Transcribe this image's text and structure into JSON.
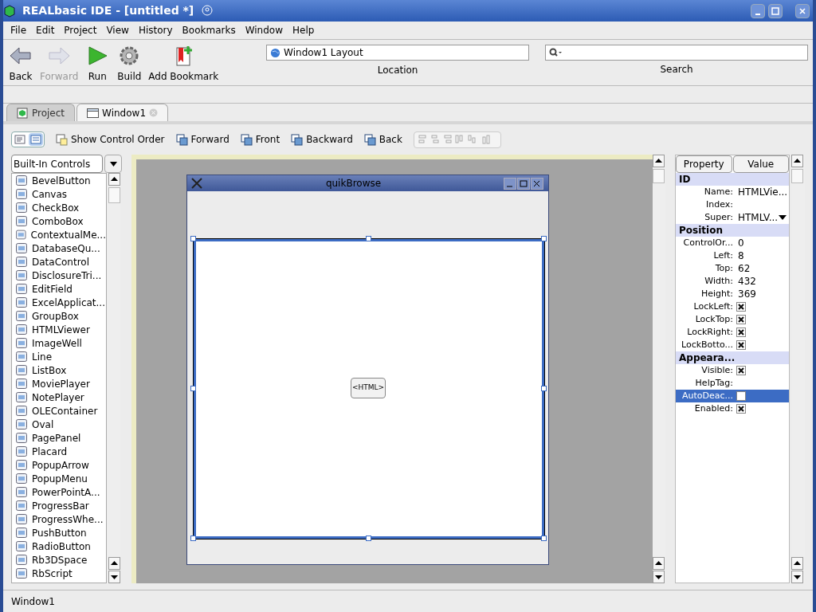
{
  "window": {
    "title": "REALbasic IDE - [untitled *]"
  },
  "menu": [
    "File",
    "Edit",
    "Project",
    "View",
    "History",
    "Bookmarks",
    "Window",
    "Help"
  ],
  "toolbar": [
    {
      "kind": "back",
      "label": "Back",
      "disabled": false
    },
    {
      "kind": "forward",
      "label": "Forward",
      "disabled": true
    },
    {
      "kind": "run",
      "label": "Run",
      "disabled": false
    },
    {
      "kind": "build",
      "label": "Build",
      "disabled": false
    },
    {
      "kind": "bookmark",
      "label": "Add Bookmark",
      "disabled": false
    }
  ],
  "location": {
    "value": "Window1 Layout",
    "label": "Location"
  },
  "search": {
    "label": "Search"
  },
  "tabs": [
    {
      "kind": "project",
      "label": "Project",
      "selected": false
    },
    {
      "kind": "window",
      "label": "Window1",
      "selected": true
    }
  ],
  "view_buttons": [
    {
      "kind": "list",
      "selected": false
    },
    {
      "kind": "layout",
      "selected": true
    }
  ],
  "layout_toolbar": [
    {
      "kind": "order",
      "label": "Show Control Order"
    },
    {
      "kind": "forward",
      "label": "Forward"
    },
    {
      "kind": "front",
      "label": "Front"
    },
    {
      "kind": "backward",
      "label": "Backward"
    },
    {
      "kind": "back",
      "label": "Back"
    }
  ],
  "controls": {
    "category": "Built-In Controls",
    "items": [
      "BevelButton",
      "Canvas",
      "CheckBox",
      "ComboBox",
      "ContextualMe...",
      "DatabaseQu...",
      "DataControl",
      "DisclosureTri...",
      "EditField",
      "ExcelApplicat...",
      "GroupBox",
      "HTMLViewer",
      "ImageWell",
      "Line",
      "ListBox",
      "MoviePlayer",
      "NotePlayer",
      "OLEContainer",
      "Oval",
      "PagePanel",
      "Placard",
      "PopupArrow",
      "PopupMenu",
      "PowerPointA...",
      "ProgressBar",
      "ProgressWhe...",
      "PushButton",
      "RadioButton",
      "Rb3DSpace",
      "RbScript"
    ]
  },
  "design_window": {
    "title": "quikBrowse",
    "control_label": "<HTML>"
  },
  "properties": {
    "columns": [
      "Property",
      "Value"
    ],
    "rows": [
      {
        "kind": "section",
        "label": "ID"
      },
      {
        "kind": "text",
        "label": "Name:",
        "value": "HTMLVie...",
        "selected": false
      },
      {
        "kind": "text",
        "label": "Index:",
        "selected": false
      },
      {
        "kind": "dropdown",
        "label": "Super:",
        "value": "HTMLV...",
        "selected": false
      },
      {
        "kind": "section",
        "label": "Position"
      },
      {
        "kind": "text",
        "label": "ControlOr...",
        "value": "0",
        "selected": false
      },
      {
        "kind": "text",
        "label": "Left:",
        "value": "8",
        "selected": false
      },
      {
        "kind": "text",
        "label": "Top:",
        "value": "62",
        "selected": false
      },
      {
        "kind": "text",
        "label": "Width:",
        "value": "432",
        "selected": false
      },
      {
        "kind": "text",
        "label": "Height:",
        "value": "369",
        "selected": false
      },
      {
        "kind": "checkbox",
        "label": "LockLeft:",
        "checked": true,
        "selected": false
      },
      {
        "kind": "checkbox",
        "label": "LockTop:",
        "checked": true,
        "selected": false
      },
      {
        "kind": "checkbox",
        "label": "LockRight:",
        "checked": true,
        "selected": false
      },
      {
        "kind": "checkbox",
        "label": "LockBotto...",
        "checked": true,
        "selected": false
      },
      {
        "kind": "section",
        "label": "Appeara..."
      },
      {
        "kind": "checkbox",
        "label": "Visible:",
        "checked": true,
        "selected": false
      },
      {
        "kind": "text",
        "label": "HelpTag:",
        "selected": false
      },
      {
        "kind": "checkbox",
        "label": "AutoDeac...",
        "checked": false,
        "selected": true
      },
      {
        "kind": "checkbox",
        "label": "Enabled:",
        "checked": true,
        "selected": false
      }
    ]
  },
  "status_bar": "Window1"
}
